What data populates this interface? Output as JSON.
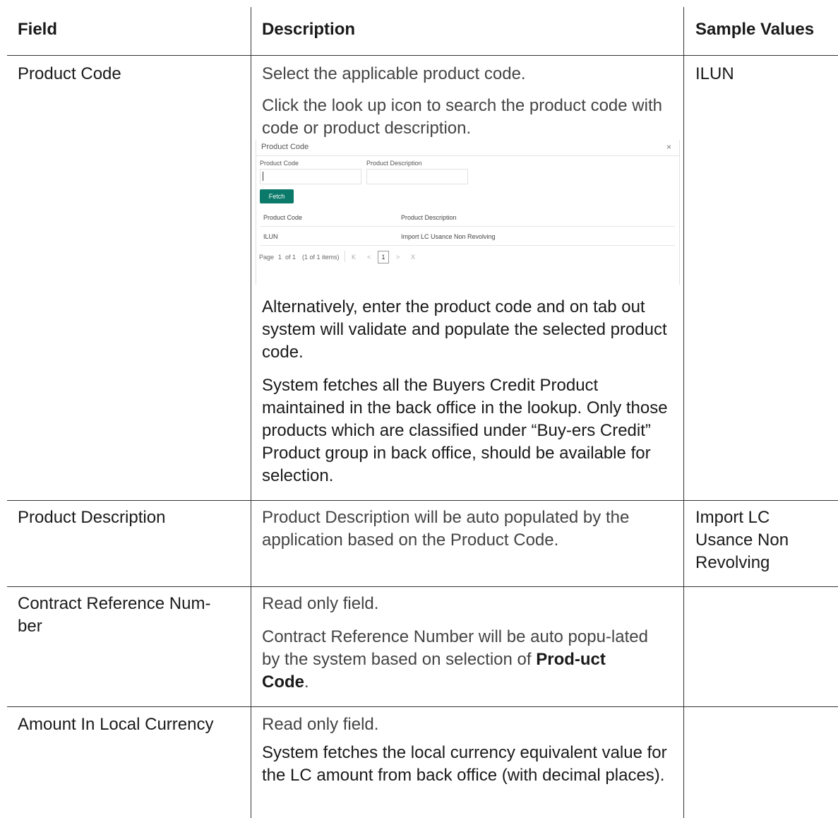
{
  "header": {
    "field": "Field",
    "description": "Description",
    "sample": "Sample Values"
  },
  "rows": [
    {
      "field": "Product Code",
      "desc": [
        "Select the applicable product code.",
        "Click the look up icon to search the product code with code or product description.",
        "Alternatively, enter the product code and on tab out system will validate and populate the selected product code.",
        "System fetches all the Buyers Credit Product maintained in the back office in the lookup. Only those products which are classified under “Buy-ers Credit” Product group in back office, should be available for selection."
      ],
      "sample": "ILUN"
    },
    {
      "field": "Product Description",
      "desc": [
        "Product Description will be auto populated by the application based on the Product Code."
      ],
      "sample_lines": [
        "Import LC",
        "Usance Non",
        "Revolving"
      ]
    },
    {
      "field_lines": [
        "Contract Reference Num-",
        "ber"
      ],
      "desc_p1": "Read only field.",
      "desc_p2": "Contract Reference Number will be auto popu-lated by the system based on selection of ",
      "desc_p2_bold": "Prod-uct Code",
      "desc_p2_end": ".",
      "sample": ""
    },
    {
      "field": "Amount In Local Currency",
      "desc": [
        "Read only field.",
        "System fetches the local currency equivalent value for the LC amount from back office (with decimal places)."
      ],
      "sample": ""
    }
  ],
  "dialog": {
    "title": "Product Code",
    "close_icon": "×",
    "label_code": "Product Code",
    "label_desc": "Product Description",
    "fetch_label": "Fetch",
    "col_code": "Product Code",
    "col_desc": "Product Description",
    "result_code": "ILUN",
    "result_desc": "Import LC Usance Non Revolving",
    "page_label": "Page",
    "page_num": "1",
    "page_of": "of 1",
    "page_items": "(1 of 1 items)",
    "nav_first": "K",
    "nav_prev": "<",
    "nav_next": ">",
    "nav_last": "X"
  }
}
